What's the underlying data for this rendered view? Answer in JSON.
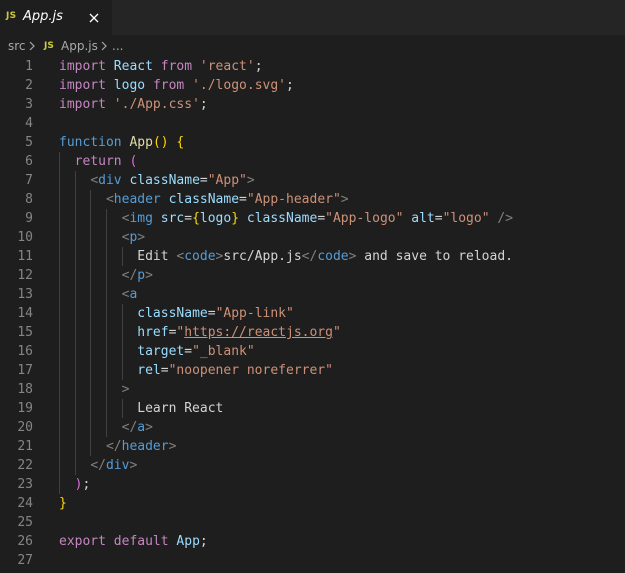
{
  "tab": {
    "icon": "JS",
    "label": "App.js",
    "close_icon": "close-icon"
  },
  "breadcrumb": {
    "folder": "src",
    "file_icon": "JS",
    "file": "App.js",
    "more": "..."
  },
  "editor": {
    "lines": [
      {
        "n": "1",
        "tokens": [
          [
            "kw",
            "import"
          ],
          [
            "txt",
            " "
          ],
          [
            "id",
            "React"
          ],
          [
            "txt",
            " "
          ],
          [
            "kw",
            "from"
          ],
          [
            "txt",
            " "
          ],
          [
            "str",
            "'react'"
          ],
          [
            "txt",
            ";"
          ]
        ]
      },
      {
        "n": "2",
        "tokens": [
          [
            "kw",
            "import"
          ],
          [
            "txt",
            " "
          ],
          [
            "id",
            "logo"
          ],
          [
            "txt",
            " "
          ],
          [
            "kw",
            "from"
          ],
          [
            "txt",
            " "
          ],
          [
            "str",
            "'./logo.svg'"
          ],
          [
            "txt",
            ";"
          ]
        ]
      },
      {
        "n": "3",
        "tokens": [
          [
            "kw",
            "import"
          ],
          [
            "txt",
            " "
          ],
          [
            "str",
            "'./App.css'"
          ],
          [
            "txt",
            ";"
          ]
        ]
      },
      {
        "n": "4",
        "tokens": []
      },
      {
        "n": "5",
        "tokens": [
          [
            "dec",
            "function"
          ],
          [
            "txt",
            " "
          ],
          [
            "fn",
            "App"
          ],
          [
            "br1",
            "()"
          ],
          [
            "txt",
            " "
          ],
          [
            "br1",
            "{"
          ]
        ]
      },
      {
        "n": "6",
        "tokens": [
          [
            "txt",
            "  "
          ],
          [
            "kw",
            "return"
          ],
          [
            "txt",
            " "
          ],
          [
            "br2",
            "("
          ]
        ]
      },
      {
        "n": "7",
        "tokens": [
          [
            "txt",
            "    "
          ],
          [
            "pun",
            "<"
          ],
          [
            "tag",
            "div"
          ],
          [
            "txt",
            " "
          ],
          [
            "id",
            "className"
          ],
          [
            "txt",
            "="
          ],
          [
            "str",
            "\"App\""
          ],
          [
            "pun",
            ">"
          ]
        ]
      },
      {
        "n": "8",
        "tokens": [
          [
            "txt",
            "      "
          ],
          [
            "pun",
            "<"
          ],
          [
            "tag",
            "header"
          ],
          [
            "txt",
            " "
          ],
          [
            "id",
            "className"
          ],
          [
            "txt",
            "="
          ],
          [
            "str",
            "\"App-header\""
          ],
          [
            "pun",
            ">"
          ]
        ]
      },
      {
        "n": "9",
        "tokens": [
          [
            "txt",
            "        "
          ],
          [
            "pun",
            "<"
          ],
          [
            "tag",
            "img"
          ],
          [
            "txt",
            " "
          ],
          [
            "id",
            "src"
          ],
          [
            "txt",
            "="
          ],
          [
            "br1",
            "{"
          ],
          [
            "id",
            "logo"
          ],
          [
            "br1",
            "}"
          ],
          [
            "txt",
            " "
          ],
          [
            "id",
            "className"
          ],
          [
            "txt",
            "="
          ],
          [
            "str",
            "\"App-logo\""
          ],
          [
            "txt",
            " "
          ],
          [
            "id",
            "alt"
          ],
          [
            "txt",
            "="
          ],
          [
            "str",
            "\"logo\""
          ],
          [
            "txt",
            " "
          ],
          [
            "pun",
            "/>"
          ]
        ]
      },
      {
        "n": "10",
        "tokens": [
          [
            "txt",
            "        "
          ],
          [
            "pun",
            "<"
          ],
          [
            "tag",
            "p"
          ],
          [
            "pun",
            ">"
          ]
        ]
      },
      {
        "n": "11",
        "tokens": [
          [
            "txt",
            "          Edit "
          ],
          [
            "pun",
            "<"
          ],
          [
            "tag",
            "code"
          ],
          [
            "pun",
            ">"
          ],
          [
            "txt",
            "src/App.js"
          ],
          [
            "pun",
            "</"
          ],
          [
            "tag",
            "code"
          ],
          [
            "pun",
            ">"
          ],
          [
            "txt",
            " and save to reload."
          ]
        ]
      },
      {
        "n": "12",
        "tokens": [
          [
            "txt",
            "        "
          ],
          [
            "pun",
            "</"
          ],
          [
            "tag",
            "p"
          ],
          [
            "pun",
            ">"
          ]
        ]
      },
      {
        "n": "13",
        "tokens": [
          [
            "txt",
            "        "
          ],
          [
            "pun",
            "<"
          ],
          [
            "tag",
            "a"
          ]
        ]
      },
      {
        "n": "14",
        "tokens": [
          [
            "txt",
            "          "
          ],
          [
            "id",
            "className"
          ],
          [
            "txt",
            "="
          ],
          [
            "str",
            "\"App-link\""
          ]
        ]
      },
      {
        "n": "15",
        "tokens": [
          [
            "txt",
            "          "
          ],
          [
            "id",
            "href"
          ],
          [
            "txt",
            "="
          ],
          [
            "str",
            "\""
          ],
          [
            "url",
            "https://reactjs.org"
          ],
          [
            "str",
            "\""
          ]
        ]
      },
      {
        "n": "16",
        "tokens": [
          [
            "txt",
            "          "
          ],
          [
            "id",
            "target"
          ],
          [
            "txt",
            "="
          ],
          [
            "str",
            "\"_blank\""
          ]
        ]
      },
      {
        "n": "17",
        "tokens": [
          [
            "txt",
            "          "
          ],
          [
            "id",
            "rel"
          ],
          [
            "txt",
            "="
          ],
          [
            "str",
            "\"noopener noreferrer\""
          ]
        ]
      },
      {
        "n": "18",
        "tokens": [
          [
            "txt",
            "        "
          ],
          [
            "pun",
            ">"
          ]
        ]
      },
      {
        "n": "19",
        "tokens": [
          [
            "txt",
            "          Learn React"
          ]
        ]
      },
      {
        "n": "20",
        "tokens": [
          [
            "txt",
            "        "
          ],
          [
            "pun",
            "</"
          ],
          [
            "tag",
            "a"
          ],
          [
            "pun",
            ">"
          ]
        ]
      },
      {
        "n": "21",
        "tokens": [
          [
            "txt",
            "      "
          ],
          [
            "pun",
            "</"
          ],
          [
            "tag",
            "header"
          ],
          [
            "pun",
            ">"
          ]
        ]
      },
      {
        "n": "22",
        "tokens": [
          [
            "txt",
            "    "
          ],
          [
            "pun",
            "</"
          ],
          [
            "tag",
            "div"
          ],
          [
            "pun",
            ">"
          ]
        ]
      },
      {
        "n": "23",
        "tokens": [
          [
            "txt",
            "  "
          ],
          [
            "br2",
            ")"
          ],
          [
            "txt",
            ";"
          ]
        ]
      },
      {
        "n": "24",
        "tokens": [
          [
            "br1",
            "}"
          ]
        ]
      },
      {
        "n": "25",
        "tokens": []
      },
      {
        "n": "26",
        "tokens": [
          [
            "kw",
            "export"
          ],
          [
            "txt",
            " "
          ],
          [
            "kw",
            "default"
          ],
          [
            "txt",
            " "
          ],
          [
            "id",
            "App"
          ],
          [
            "txt",
            ";"
          ]
        ]
      },
      {
        "n": "27",
        "tokens": []
      }
    ]
  },
  "colors": {
    "editor_bg": "#1e1e1e",
    "tabbar_bg": "#252526",
    "js_icon": "#cbcb41",
    "keyword": "#c586c0",
    "storage": "#569cd6",
    "function": "#dcdcaa",
    "variable": "#9cdcfe",
    "string": "#ce9178",
    "line_number": "#858585"
  }
}
